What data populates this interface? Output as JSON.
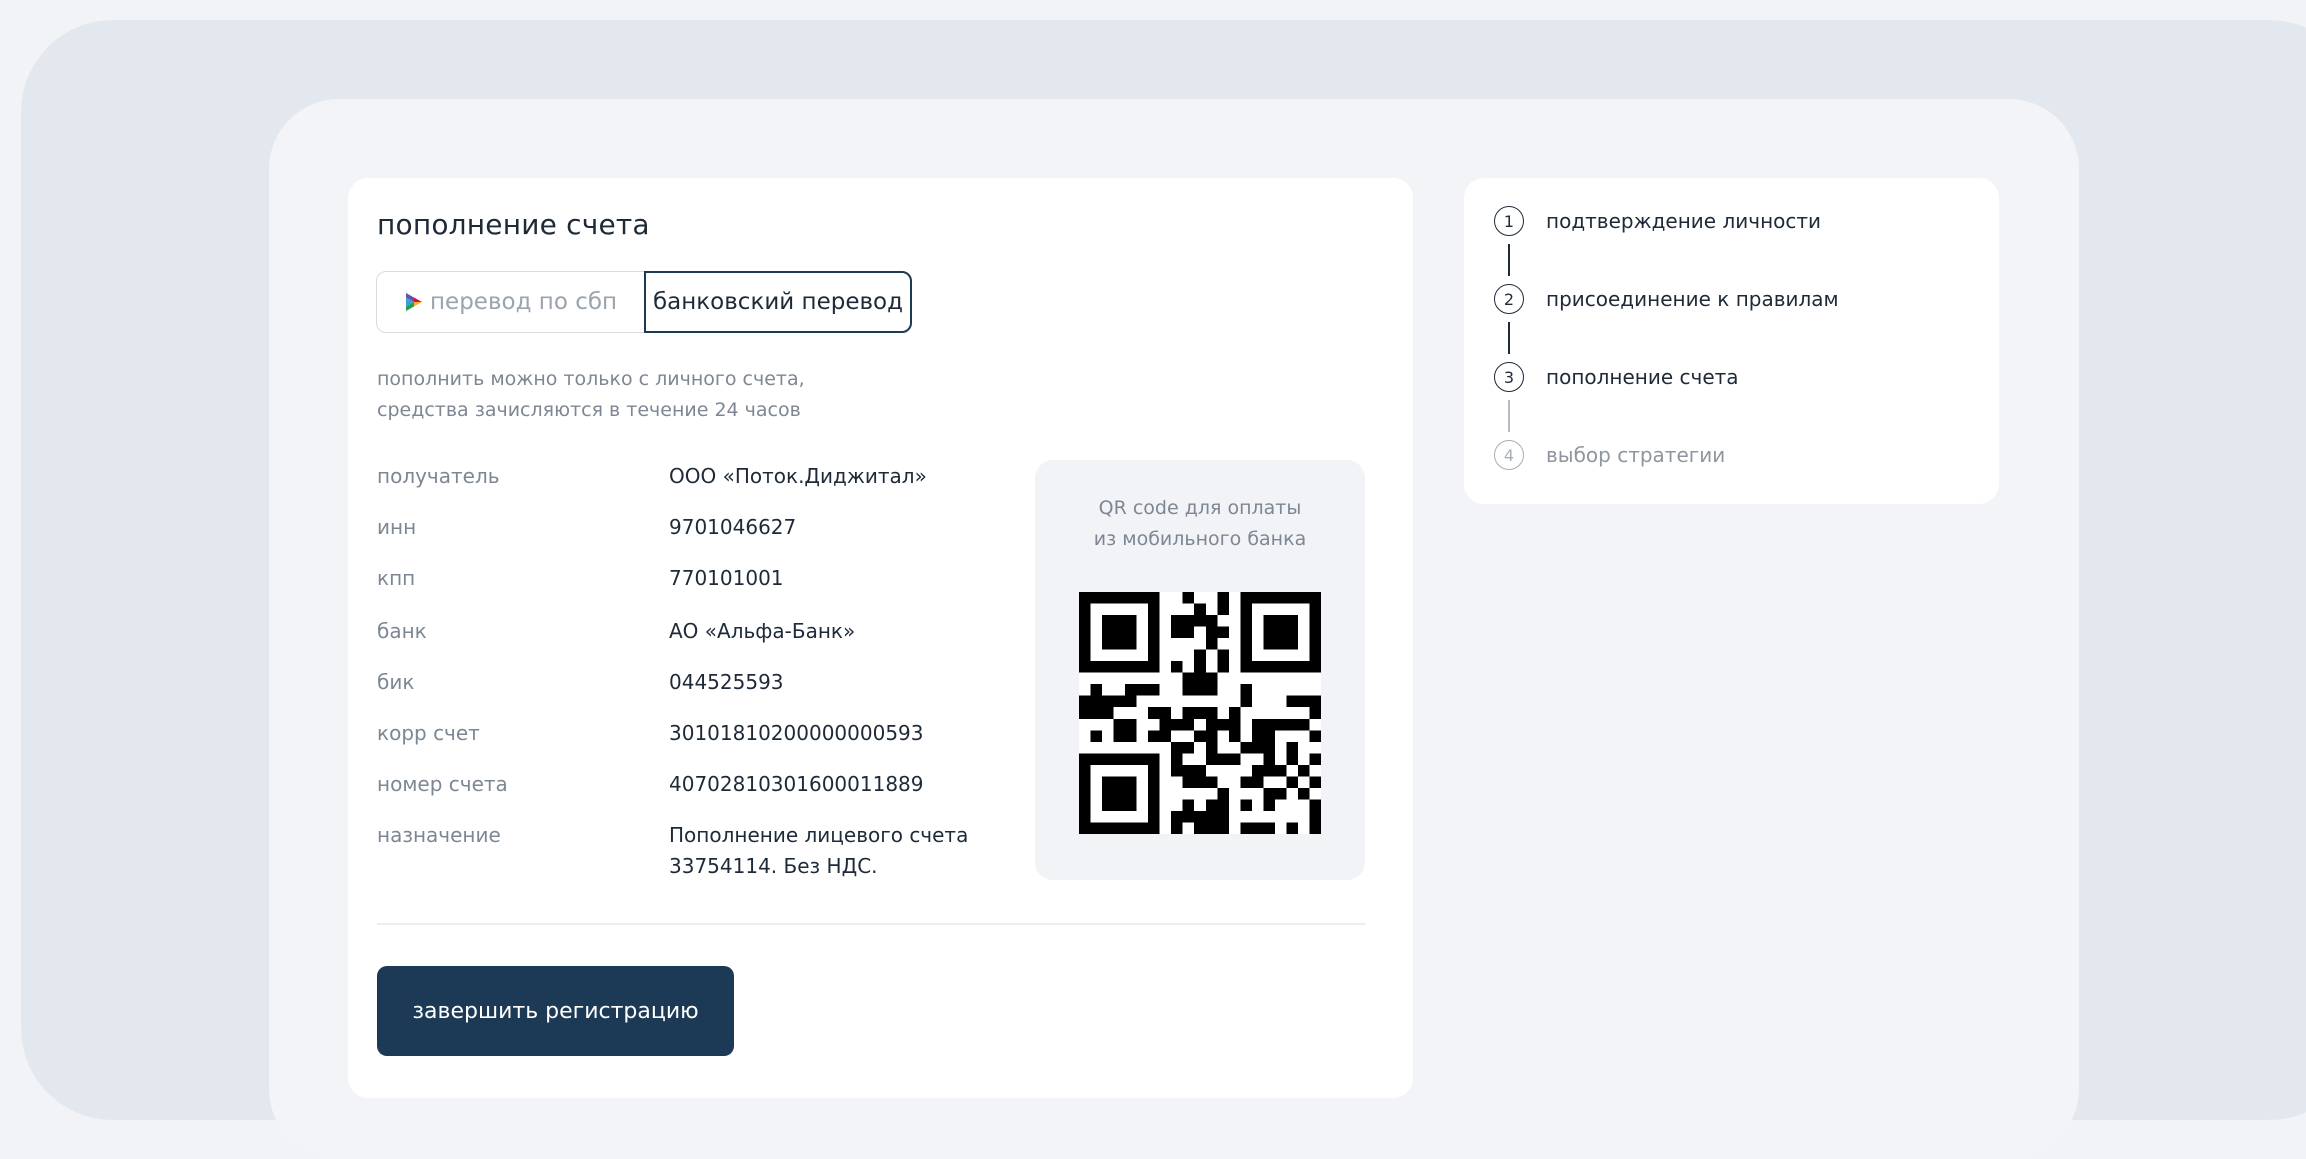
{
  "account_topup": {
    "title": "пополнение счета",
    "tabs": {
      "sbp_label": "перевод по сбп",
      "bank_label": "банковский перевод",
      "active": "bank"
    },
    "hint_line1": "пополнить можно только с личного счета,",
    "hint_line2": "средства зачисляются в течение 24 часов",
    "details": [
      {
        "label": "получатель",
        "value": "ООО «Поток.Диджитал»"
      },
      {
        "label": "инн",
        "value": "9701046627"
      },
      {
        "label": "кпп",
        "value": "770101001"
      },
      {
        "label": "банк",
        "value": "АО «Альфа-Банк»"
      },
      {
        "label": "бик",
        "value": "044525593"
      },
      {
        "label": "корр счет",
        "value": "30101810200000000593"
      },
      {
        "label": "номер счета",
        "value": "40702810301600011889"
      },
      {
        "label": "назначение",
        "value": "Пополнение лицевого счета 33754114. Без НДС."
      }
    ],
    "qr_caption_line1": "QR code для оплаты",
    "qr_caption_line2": "из  мобильного банка",
    "finish_button_label": "завершить регистрацию"
  },
  "steps": [
    {
      "number": "1",
      "label": "подтверждение личности",
      "state": "done"
    },
    {
      "number": "2",
      "label": "присоединение к правилам",
      "state": "done"
    },
    {
      "number": "3",
      "label": "пополнение счета",
      "state": "current"
    },
    {
      "number": "4",
      "label": "выбор стратегии",
      "state": "upcoming"
    }
  ],
  "colors": {
    "accent": "#1c3a55",
    "text_primary": "#1e2a38",
    "text_muted": "#7d8793",
    "background": "#f1f3f7"
  }
}
